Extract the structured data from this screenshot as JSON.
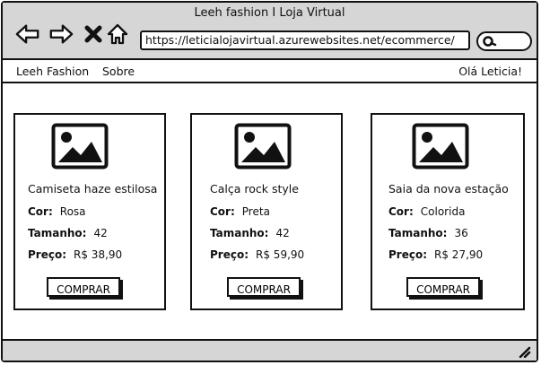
{
  "window": {
    "title": "Leeh fashion I Loja Virtual"
  },
  "browser": {
    "back_icon": "arrow-left-icon",
    "forward_icon": "arrow-right-icon",
    "stop_icon": "close-icon",
    "home_icon": "home-icon",
    "url": "https://leticialojavirtual.azurewebsites.net/ecommerce/",
    "search_icon": "search-icon"
  },
  "menu": {
    "brand": "Leeh Fashion",
    "about": "Sobre",
    "greeting": "Olá Leticia!"
  },
  "products": [
    {
      "name": "Camiseta haze estilosa",
      "color_label": "Cor:",
      "color": "Rosa",
      "size_label": "Tamanho:",
      "size": "42",
      "price_label": "Preço:",
      "price": "R$ 38,90",
      "button": "COMPRAR"
    },
    {
      "name": "Calça rock style",
      "color_label": "Cor:",
      "color": "Preta",
      "size_label": "Tamanho:",
      "size": "42",
      "price_label": "Preço:",
      "price": "R$ 59,90",
      "button": "COMPRAR"
    },
    {
      "name": "Saia da nova estação",
      "color_label": "Cor:",
      "color": "Colorida",
      "size_label": "Tamanho:",
      "size": "36",
      "price_label": "Preço:",
      "price": "R$ 27,90",
      "button": "COMPRAR"
    }
  ]
}
